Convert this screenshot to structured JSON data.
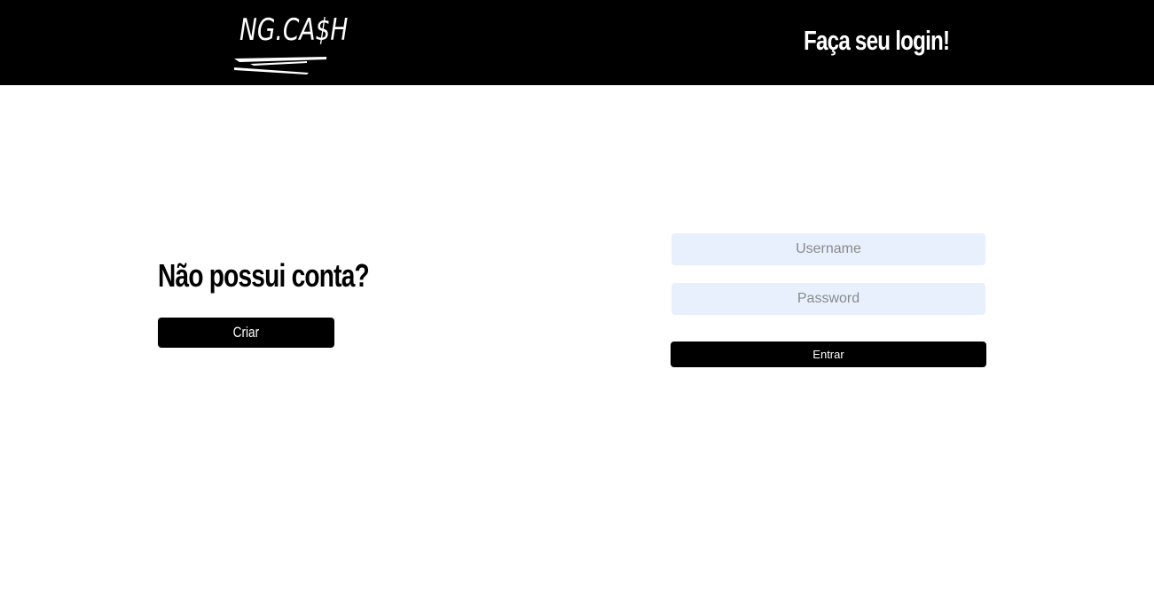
{
  "header": {
    "logo_text": "NG.CA$H",
    "title": "Faça seu login!"
  },
  "signup": {
    "prompt": "Não possui conta?",
    "button_label": "Criar"
  },
  "login": {
    "username_placeholder": "Username",
    "username_value": "",
    "password_placeholder": "Password",
    "password_value": "",
    "submit_label": "Entrar"
  },
  "colors": {
    "header_bg": "#000000",
    "input_bg": "#e8f0fe",
    "button_bg": "#000000",
    "text_on_dark": "#ffffff"
  }
}
